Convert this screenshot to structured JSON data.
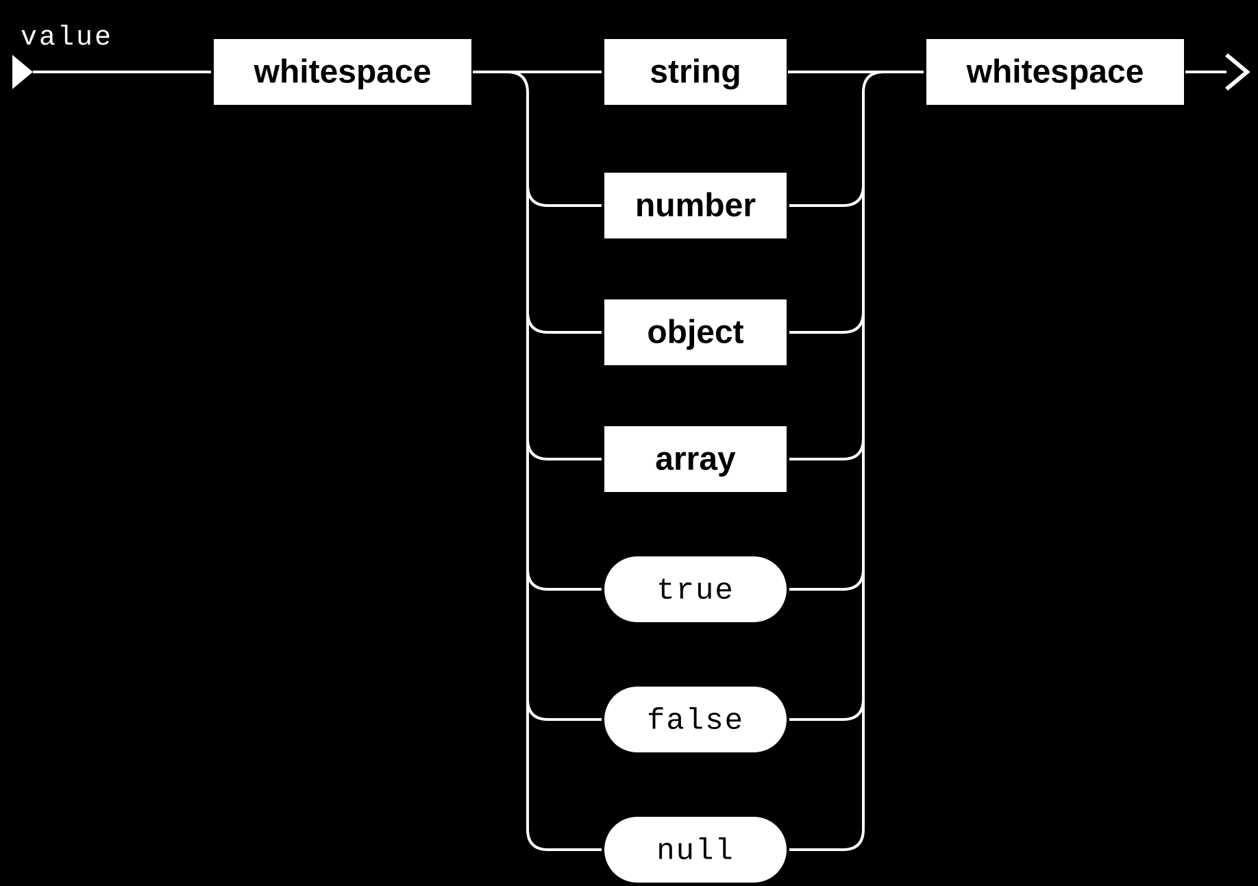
{
  "title": "value",
  "boxes": {
    "ws_left": "whitespace",
    "ws_right": "whitespace",
    "string": "string",
    "number": "number",
    "object": "object",
    "array": "array"
  },
  "literals": {
    "true": "true",
    "false": "false",
    "null": "null"
  }
}
